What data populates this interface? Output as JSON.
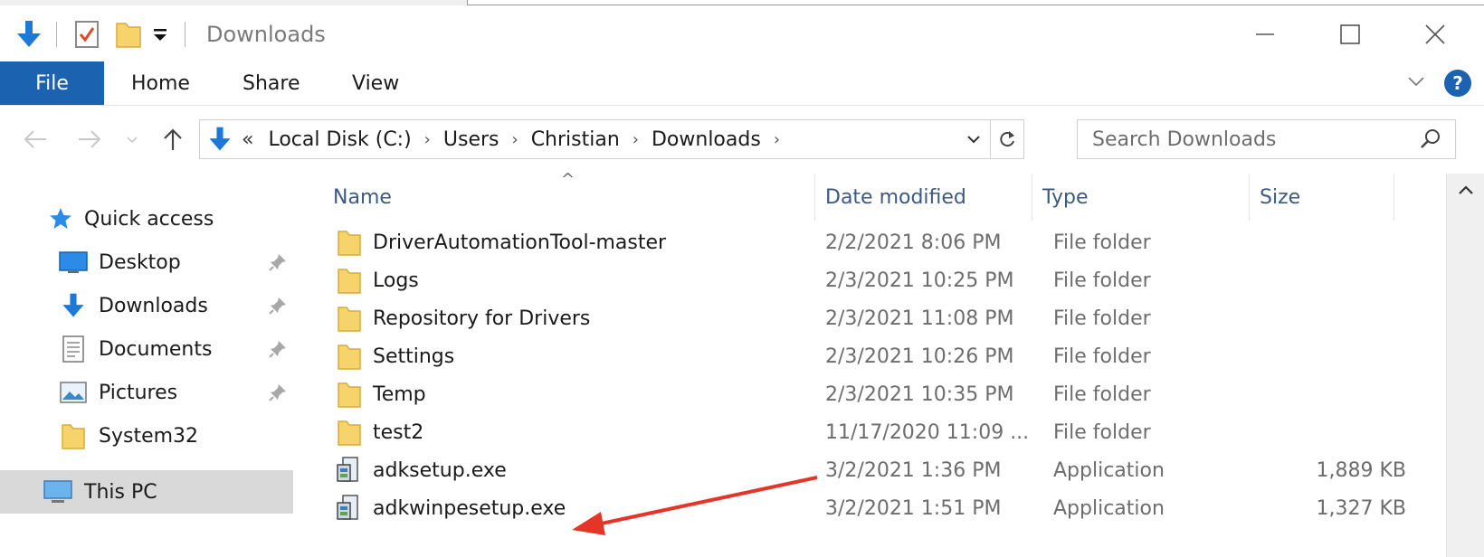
{
  "window": {
    "title": "Downloads"
  },
  "ribbon": {
    "file_tab": "File",
    "tabs": [
      "Home",
      "Share",
      "View"
    ],
    "help": "?"
  },
  "address": {
    "overflow": "«",
    "crumbs": [
      "Local Disk (C:)",
      "Users",
      "Christian",
      "Downloads"
    ]
  },
  "search": {
    "placeholder": "Search Downloads"
  },
  "sidebar": {
    "quick_access": "Quick access",
    "items": [
      {
        "label": "Desktop",
        "icon": "desktop-icon",
        "pinned": true
      },
      {
        "label": "Downloads",
        "icon": "download-arrow-icon",
        "pinned": true
      },
      {
        "label": "Documents",
        "icon": "documents-icon",
        "pinned": true
      },
      {
        "label": "Pictures",
        "icon": "pictures-icon",
        "pinned": true
      },
      {
        "label": "System32",
        "icon": "folder-icon",
        "pinned": false
      }
    ],
    "this_pc": "This PC"
  },
  "columns": [
    "Name",
    "Date modified",
    "Type",
    "Size"
  ],
  "files": [
    {
      "name": "DriverAutomationTool-master",
      "date": "2/2/2021 8:06 PM",
      "type": "File folder",
      "size": "",
      "icon": "folder-icon"
    },
    {
      "name": "Logs",
      "date": "2/3/2021 10:25 PM",
      "type": "File folder",
      "size": "",
      "icon": "folder-icon"
    },
    {
      "name": "Repository for Drivers",
      "date": "2/3/2021 11:08 PM",
      "type": "File folder",
      "size": "",
      "icon": "folder-icon"
    },
    {
      "name": "Settings",
      "date": "2/3/2021 10:26 PM",
      "type": "File folder",
      "size": "",
      "icon": "folder-icon"
    },
    {
      "name": "Temp",
      "date": "2/3/2021 10:35 PM",
      "type": "File folder",
      "size": "",
      "icon": "folder-icon"
    },
    {
      "name": "test2",
      "date": "11/17/2020 11:09 ...",
      "type": "File folder",
      "size": "",
      "icon": "folder-icon"
    },
    {
      "name": "adksetup.exe",
      "date": "3/2/2021 1:36 PM",
      "type": "Application",
      "size": "1,889 KB",
      "icon": "installer-icon"
    },
    {
      "name": "adkwinpesetup.exe",
      "date": "3/2/2021 1:51 PM",
      "type": "Application",
      "size": "1,327 KB",
      "icon": "installer-icon"
    }
  ],
  "colors": {
    "accent": "#1b62b0",
    "annotation_arrow": "#e53529",
    "folder": "#f7d36b"
  }
}
